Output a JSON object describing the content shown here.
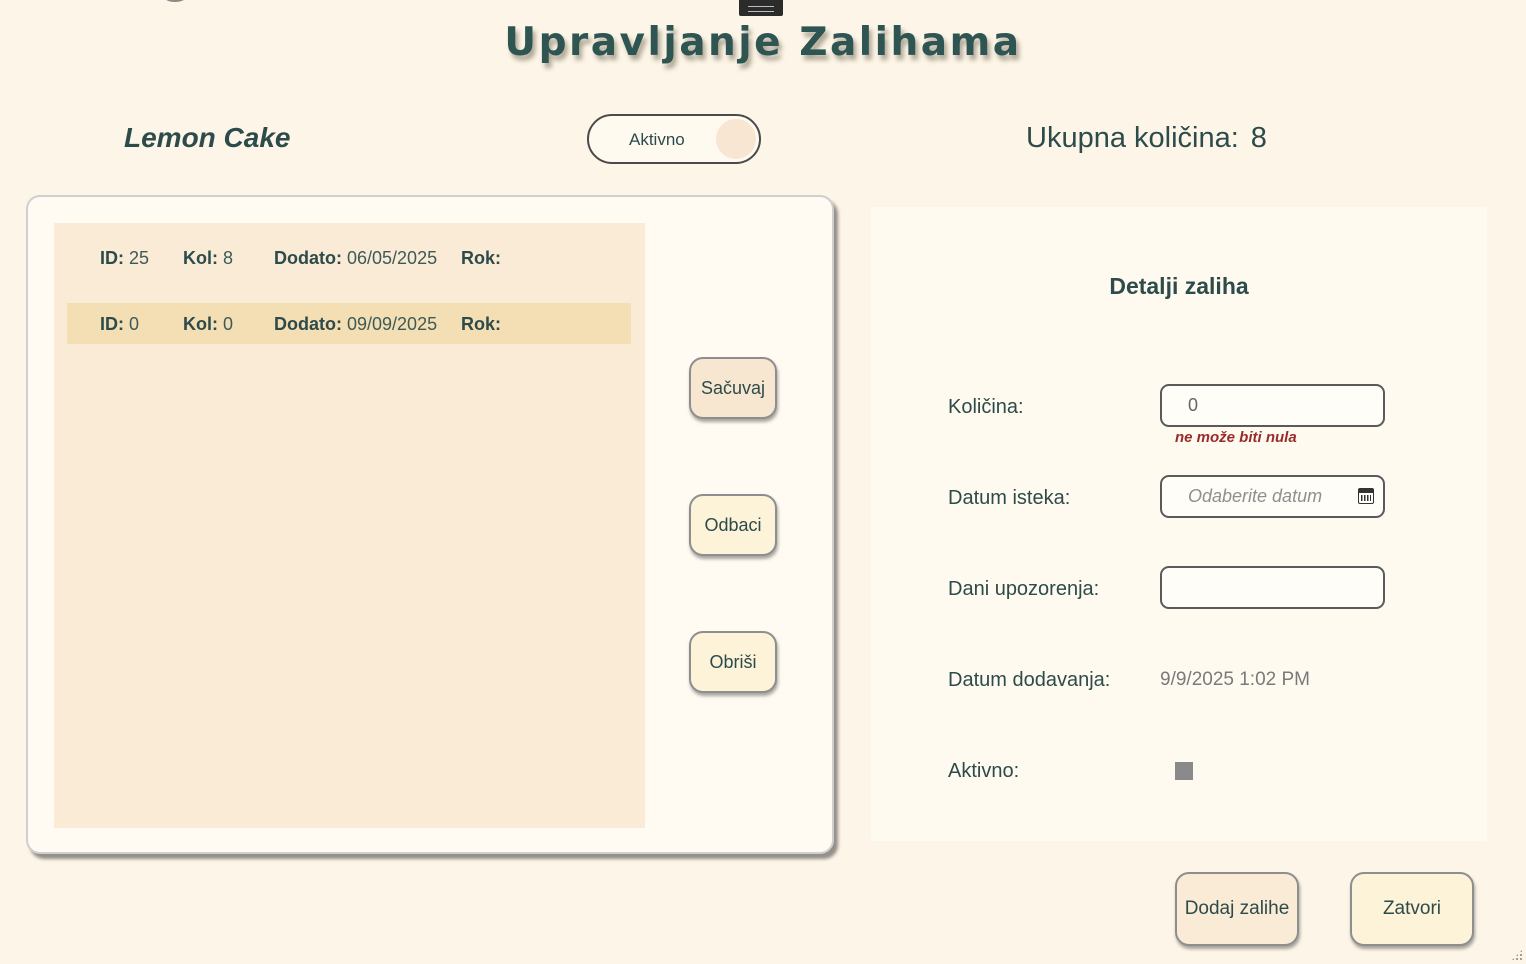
{
  "title": "Upravljanje Zalihama",
  "product": {
    "name": "Lemon Cake",
    "status_toggle": "Aktivno",
    "total_label": "Ukupna količina:",
    "total_value": "8"
  },
  "list": {
    "field_labels": {
      "id": "ID:",
      "qty": "Kol:",
      "added": "Dodato:",
      "expiry": "Rok:"
    },
    "rows": [
      {
        "id": "25",
        "qty": "8",
        "added": "06/05/2025",
        "expiry": ""
      },
      {
        "id": "0",
        "qty": "0",
        "added": "09/09/2025",
        "expiry": ""
      }
    ],
    "selected_row": 1
  },
  "actions": {
    "save": "Sačuvaj",
    "discard": "Odbaci",
    "delete": "Obriši"
  },
  "details": {
    "title": "Detalji zaliha",
    "quantity_label": "Količina:",
    "quantity_value": "0",
    "quantity_error": "ne može biti nula",
    "expiry_label": "Datum isteka:",
    "expiry_placeholder": "Odaberite datum",
    "warning_days_label": "Dani upozorenja:",
    "warning_days_value": "",
    "date_added_label": "Datum dodavanja:",
    "date_added_value": "9/9/2025 1:02 PM",
    "active_label": "Aktivno:",
    "active_checked": false
  },
  "footer": {
    "add_stock": "Dodaj zalihe",
    "close": "Zatvori"
  },
  "colors": {
    "background": "#fdf5e7",
    "text": "#2d4b4a",
    "selected_row": "#f4deb3",
    "error": "#9a2b2b"
  },
  "icons": {
    "calendar": "calendar-icon"
  }
}
